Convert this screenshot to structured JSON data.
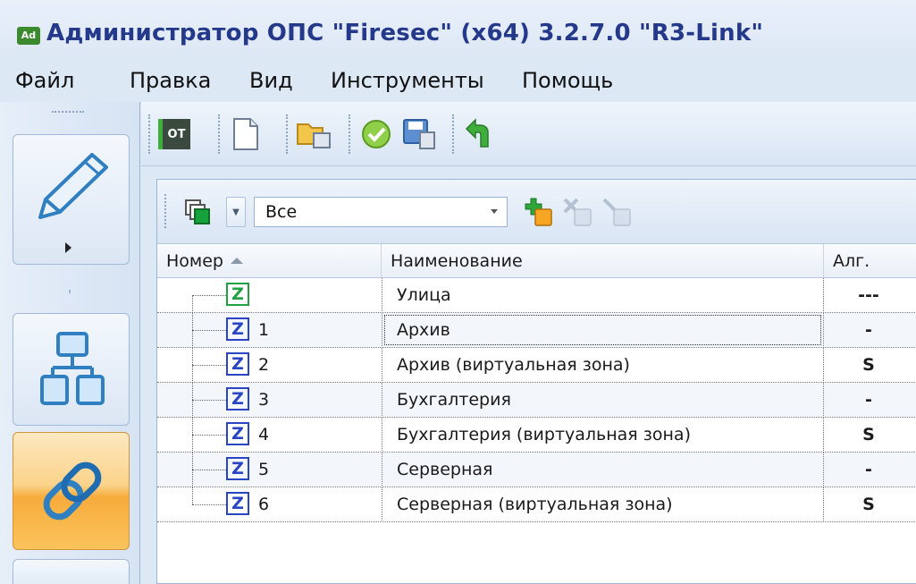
{
  "window": {
    "logo_text": "Ad",
    "title": "Администратор ОПС \"Firesec\"  (x64) 3.2.7.0   \"R3-Link\""
  },
  "menu": {
    "items": [
      {
        "label": "Файл"
      },
      {
        "label": "Правка"
      },
      {
        "label": "Вид"
      },
      {
        "label": "Инструменты"
      },
      {
        "label": "Помощь"
      }
    ]
  },
  "sidebar": {
    "buttons": [
      {
        "icon": "pencil-icon",
        "active": false
      },
      {
        "icon": "network-icon",
        "active": false
      },
      {
        "icon": "chain-link-icon",
        "active": true
      }
    ]
  },
  "toolbar": {
    "ot_label": "OT",
    "icons": [
      "ot-icon",
      "new-document-icon",
      "open-folder-icon",
      "check-icon",
      "save-icon",
      "undo-arrow-icon"
    ]
  },
  "filter": {
    "value": "Все"
  },
  "grid": {
    "columns": [
      "Номер",
      "Наименование",
      "Алг."
    ],
    "rows": [
      {
        "number": "",
        "name": "Улица",
        "alg": "---",
        "icon_color": "green"
      },
      {
        "number": "1",
        "name": "Архив",
        "alg": "-",
        "icon_color": "blue"
      },
      {
        "number": "2",
        "name": "Архив (виртуальная зона)",
        "alg": "S",
        "icon_color": "blue"
      },
      {
        "number": "3",
        "name": "Бухгалтерия",
        "alg": "-",
        "icon_color": "blue"
      },
      {
        "number": "4",
        "name": "Бухгалтерия (виртуальная зона)",
        "alg": "S",
        "icon_color": "blue"
      },
      {
        "number": "5",
        "name": "Серверная",
        "alg": "-",
        "icon_color": "blue"
      },
      {
        "number": "6",
        "name": "Серверная (виртуальная зона)",
        "alg": "S",
        "icon_color": "blue"
      }
    ],
    "zone_icon_letter": "Z"
  },
  "colors": {
    "title": "#25398a",
    "active_nav": "#f7ac3b",
    "zone_blue": "#2a45c4",
    "zone_green": "#22a043"
  }
}
